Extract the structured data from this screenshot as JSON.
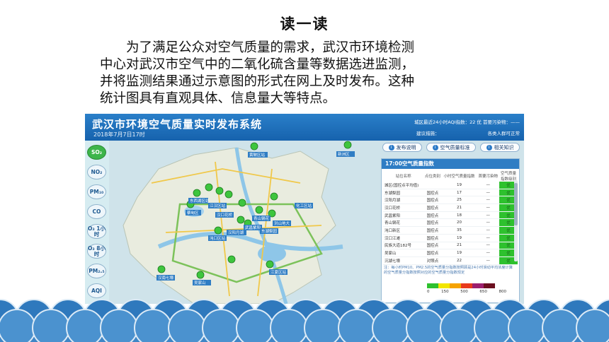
{
  "slide": {
    "title": "读一读",
    "lines": [
      "为了满足公众对空气质量的需求，武汉市环境检测",
      "中心对武汉市空气中的二氧化硫含量等数据选进监测，",
      "并将监测结果通过示意图的形式在网上及时发布。这种",
      "统计图具有直观具体、信息量大等特点。"
    ]
  },
  "app": {
    "title": "武汉市环境空气质量实时发布系统",
    "date": "2018年7月7日17时",
    "header_right_1": "城区最近24小时AQI指数：22 优  首要污染物：——",
    "header_right_2": "建议措施：",
    "header_right_3": "各类人群可正常",
    "pollutants": [
      "SO₂",
      "NO₂",
      "PM₁₀",
      "CO",
      "O₃ 1小时",
      "O₃ 8小时",
      "PM₂.₅",
      "AQI"
    ],
    "buttons": [
      "发布说明",
      "空气质量标准",
      "相关知识"
    ],
    "panel_title": "17:00空气质量指数",
    "table_headers": [
      "站位名称",
      "点位类别",
      "小时空气质量指数",
      "首要污染物",
      "空气质量指数级别"
    ],
    "rows": [
      {
        "name": "城区(国控点平均值)",
        "type": "",
        "aqi": "19",
        "pollutant": "—",
        "level": "优"
      },
      {
        "name": "东湖梨园",
        "type": "国控点",
        "aqi": "17",
        "pollutant": "—",
        "level": "优"
      },
      {
        "name": "汉阳月湖",
        "type": "国控点",
        "aqi": "25",
        "pollutant": "—",
        "level": "优"
      },
      {
        "name": "汉口花桥",
        "type": "国控点",
        "aqi": "21",
        "pollutant": "—",
        "level": "优"
      },
      {
        "name": "武昌紫阳",
        "type": "国控点",
        "aqi": "18",
        "pollutant": "—",
        "level": "优"
      },
      {
        "name": "青山钢花",
        "type": "国控点",
        "aqi": "20",
        "pollutant": "—",
        "level": "优"
      },
      {
        "name": "沌口新区",
        "type": "国控点",
        "aqi": "35",
        "pollutant": "—",
        "level": "优"
      },
      {
        "name": "汉口江滩",
        "type": "国控点",
        "aqi": "19",
        "pollutant": "—",
        "level": "优"
      },
      {
        "name": "民族大道182号",
        "type": "国控点",
        "aqi": "21",
        "pollutant": "—",
        "level": "优"
      },
      {
        "name": "吴家山",
        "type": "国控点",
        "aqi": "19",
        "pollutant": "—",
        "level": "优"
      },
      {
        "name": "沉湖七壕",
        "type": "对照点",
        "aqi": "22",
        "pollutant": "—",
        "level": "优"
      }
    ],
    "note": "注：每小时PM10、PM2.5的空气质量分指数按照顾是24小时滑动平均浓度计算的空气质量分指数按照对应的空气质量分指数规定",
    "legend_labels": [
      "0",
      "150",
      "500",
      "650",
      "800"
    ],
    "legend_colors": [
      "#2ec12e",
      "#f2e600",
      "#f5a300",
      "#e83a1c",
      "#9b1f6e",
      "#6b0f1f"
    ],
    "map_labels": [
      "黄陂区站",
      "新洲区",
      "东西湖区站",
      "蔡甸区",
      "江汉区站",
      "汉口花桥",
      "青山钢花",
      "化工区站",
      "沌口区站",
      "汉阳月湖",
      "武昌紫阳",
      "东湖梨园",
      "洪山地大",
      "民族大道",
      "江夏区站",
      "汉南七壕",
      "吴家山",
      "沌口新区"
    ]
  }
}
